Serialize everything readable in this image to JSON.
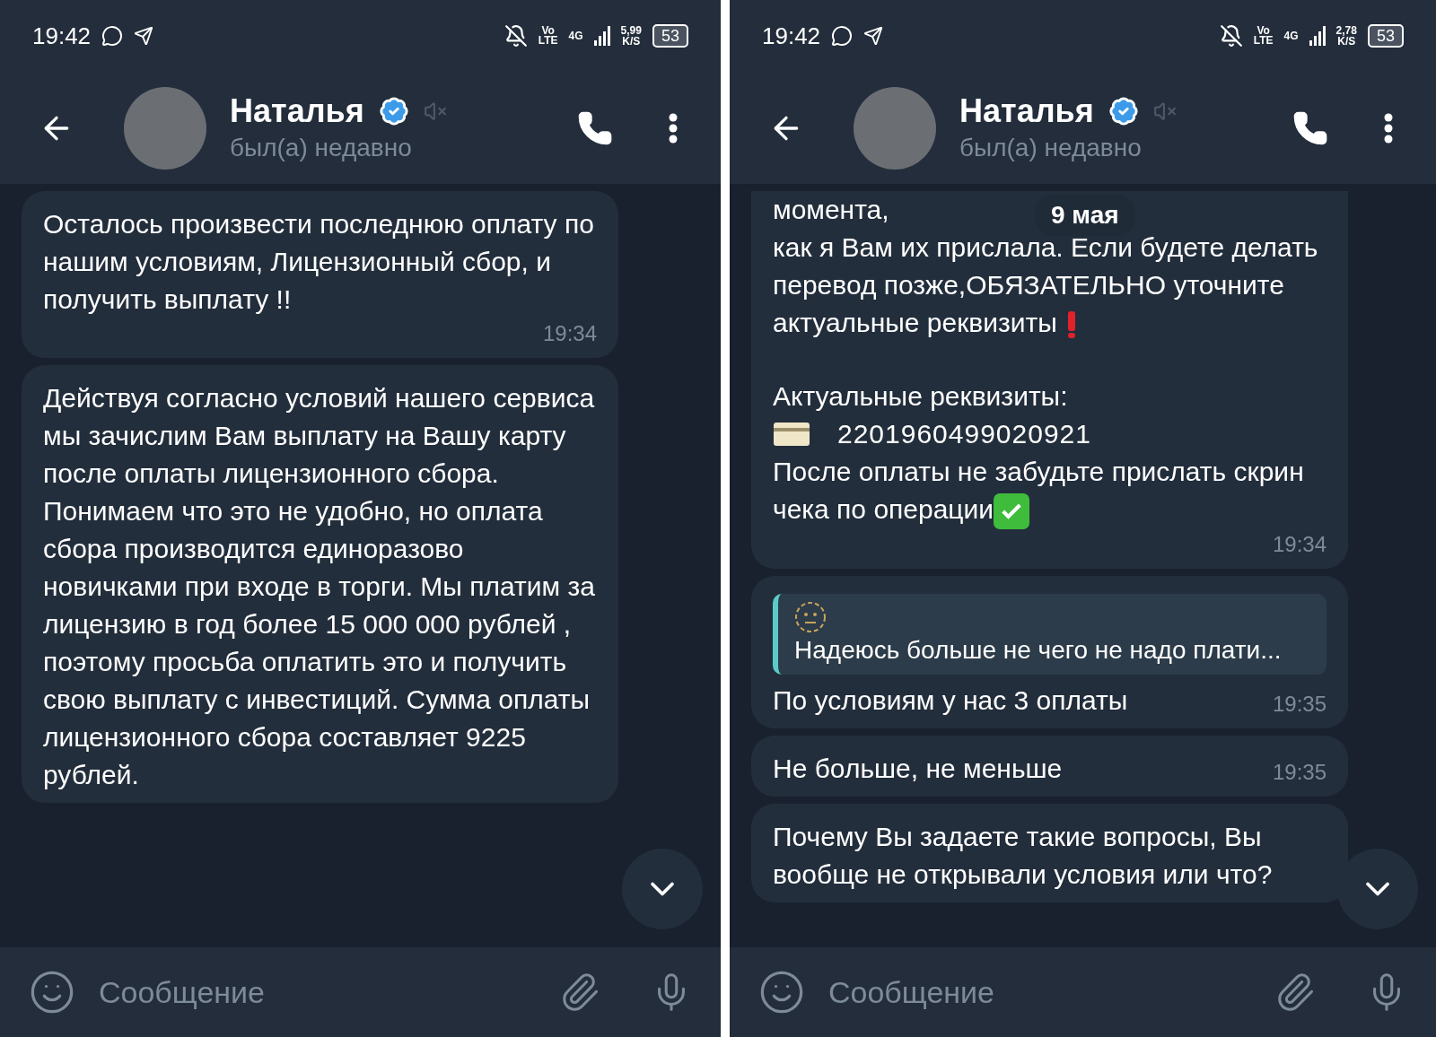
{
  "panels": [
    {
      "status_bar": {
        "time": "19:42",
        "network_top": "Vo",
        "network_bottom": "LTE",
        "generation": "4G",
        "speed": "5,99",
        "speed_unit": "K/S",
        "battery": "53"
      },
      "header": {
        "name": "Наталья",
        "verified": true,
        "muted": true,
        "last_seen": "был(а) недавно"
      },
      "messages": [
        {
          "lines": [
            {
              "kind": "text",
              "text": "Осталось произвести последнюю оплату по нашим условиям, Лицензионный сбор, и получить выплату !!"
            }
          ],
          "time": "19:34"
        },
        {
          "lines": [
            {
              "kind": "text",
              "text": "Действуя согласно условий нашего сервиса мы зачислим Вам выплату на Вашу карту после оплаты лицензионного сбора. Понимаем что это не удобно, но оплата сбора производится единоразово новичками при входе в торги. Мы платим за лицензию в год более 15 000 000 рублей , поэтому просьба оплатить это и получить свою выплату с инвестиций. Сумма оплаты лицензионного сбора составляет 9225 рублей."
            }
          ]
        }
      ],
      "input": {
        "placeholder": "Сообщение"
      }
    },
    {
      "status_bar": {
        "time": "19:42",
        "network_top": "Vo",
        "network_bottom": "LTE",
        "generation": "4G",
        "speed": "2,78",
        "speed_unit": "K/S",
        "battery": "53"
      },
      "header": {
        "name": "Наталья",
        "verified": true,
        "muted": true,
        "last_seen": "был(а) недавно"
      },
      "date_badge": "9 мая",
      "messages": [
        {
          "lines": [
            {
              "kind": "text",
              "text": "момента,"
            },
            {
              "kind": "text-alert",
              "text": "как я Вам их прислала. Если будете делать перевод позже,ОБЯЗАТЕЛЬНО уточните актуальные реквизиты"
            },
            {
              "kind": "gap"
            },
            {
              "kind": "text",
              "text": "Актуальные реквизиты:"
            },
            {
              "kind": "card",
              "text": "2201960499020921"
            },
            {
              "kind": "text-check",
              "text": "После оплаты не забудьте прислать скрин чека по операции"
            }
          ],
          "time": "19:34",
          "cut_top": true
        },
        {
          "reply": {
            "text": "Надеюсь больше не чего не надо плати..."
          },
          "lines": [
            {
              "kind": "text",
              "text": "По условиям у нас 3 оплаты"
            }
          ],
          "time": "19:35"
        },
        {
          "lines": [
            {
              "kind": "text",
              "text": "Не больше, не меньше"
            }
          ],
          "time": "19:35"
        },
        {
          "lines": [
            {
              "kind": "text",
              "text": "Почему Вы задаете такие вопросы, Вы вообще не открывали условия или что?"
            }
          ]
        }
      ],
      "input": {
        "placeholder": "Сообщение"
      }
    }
  ]
}
